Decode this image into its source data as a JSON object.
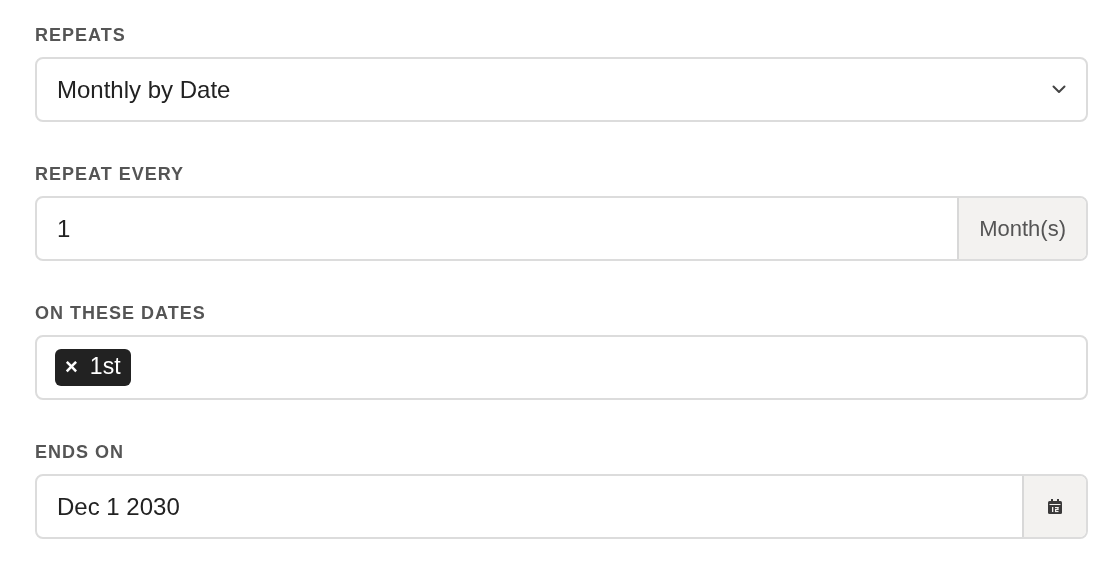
{
  "fields": [
    {
      "kind": "select",
      "label": "REPEATS",
      "value": "Monthly by Date"
    },
    {
      "kind": "addon",
      "label": "REPEAT EVERY",
      "value": "1",
      "addon": "Month(s)"
    },
    {
      "kind": "tags",
      "label": "ON THESE DATES",
      "tags": [
        {
          "remove": "×",
          "text": "1st"
        }
      ]
    },
    {
      "kind": "date",
      "label": "ENDS ON",
      "value": "Dec 1 2030"
    }
  ]
}
